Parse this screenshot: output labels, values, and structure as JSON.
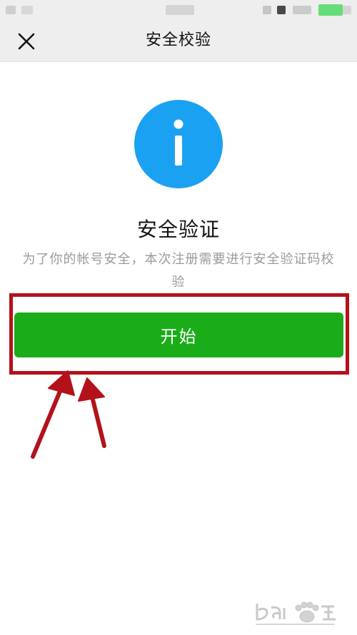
{
  "nav": {
    "title": "安全校验",
    "close_icon": "close-icon"
  },
  "info_icon": "info-icon",
  "content": {
    "heading": "安全验证",
    "description": "为了你的帐号安全，本次注册需要进行安全验证码校验"
  },
  "start_button": {
    "label": "开始"
  },
  "colors": {
    "nav_bg": "#eeeeee",
    "accent_blue": "#1ba1f2",
    "button_green": "#1aad19",
    "highlight_red": "#b3121a"
  }
}
